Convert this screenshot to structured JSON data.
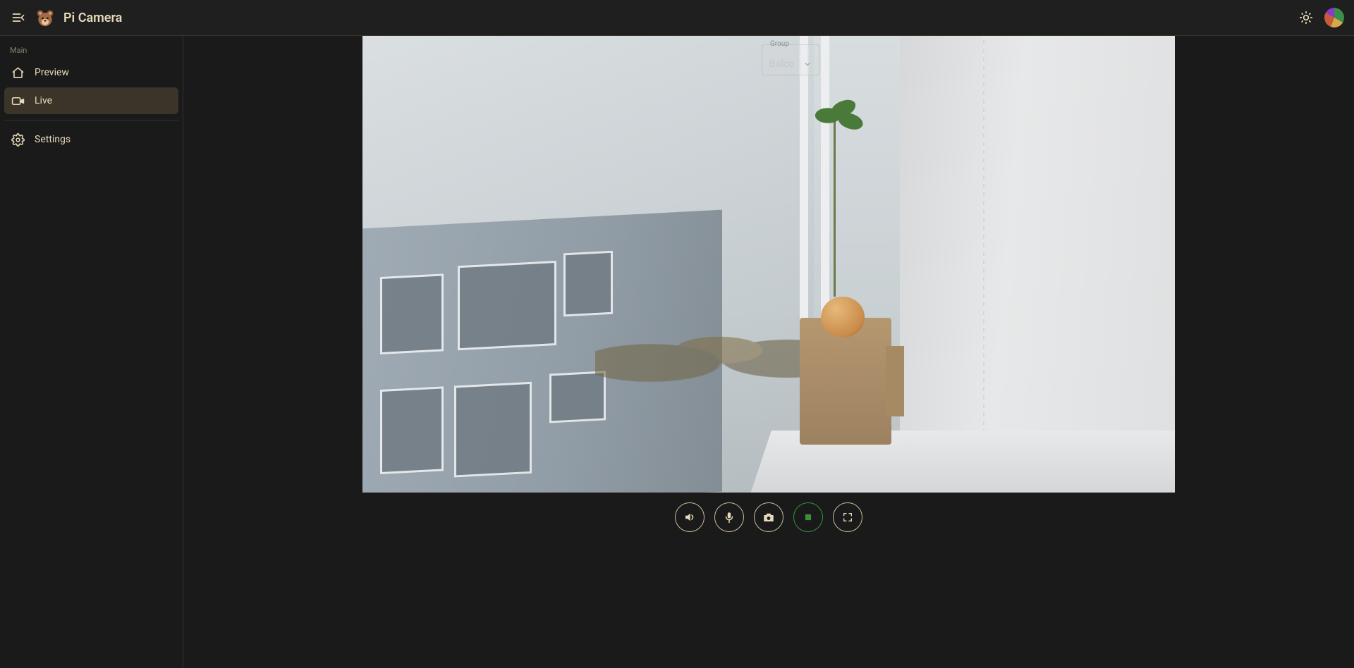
{
  "header": {
    "app_title": "Pi Camera"
  },
  "sidebar": {
    "section_label": "Main",
    "items": [
      {
        "label": "Preview",
        "icon": "home-icon",
        "active": false
      },
      {
        "label": "Live",
        "icon": "video-icon",
        "active": true
      },
      {
        "label": "Settings",
        "icon": "gear-icon",
        "active": false
      }
    ]
  },
  "overlay": {
    "group_field_legend": "Group",
    "group_field_value": "Balco"
  },
  "controls": {
    "volume": "Volume",
    "mic": "Microphone",
    "snapshot": "Snapshot",
    "stop": "Stop",
    "fullscreen": "Fullscreen"
  }
}
